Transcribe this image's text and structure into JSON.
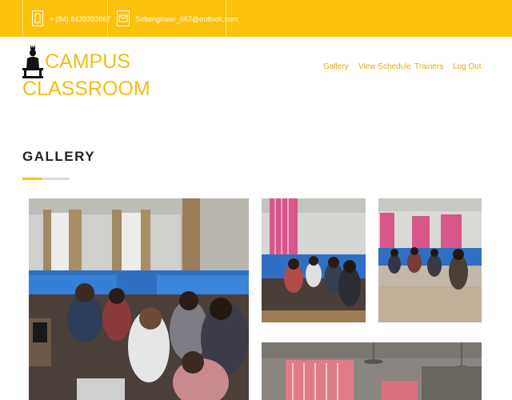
{
  "topbar": {
    "phone": "+ (84) 8439393667",
    "email": "Softengineer_667@outlook.com",
    "phone_icon": "phone-icon",
    "email_icon": "envelope-icon",
    "background": "#fcc10b"
  },
  "logo": {
    "line1": "CAMPUS",
    "line2": "CLASSROOM",
    "icon": "student-at-desk-icon",
    "color": "#f4bd14"
  },
  "nav": {
    "items": [
      "Gallery",
      "View Schedule",
      "Trainers",
      "Log Out"
    ],
    "color": "#e3ac14"
  },
  "main": {
    "title": "GALLERY",
    "photos": [
      "classroom-photo-large",
      "classroom-photo-2",
      "classroom-photo-3",
      "classroom-photo-4"
    ]
  }
}
